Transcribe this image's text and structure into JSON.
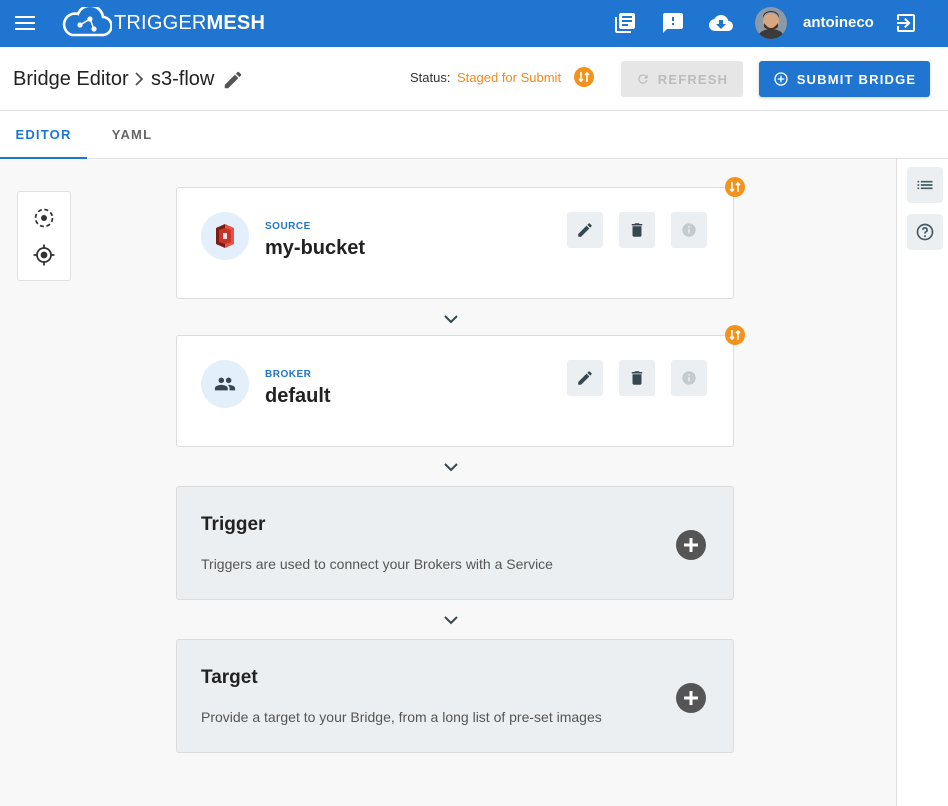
{
  "app": {
    "brand_light": "TRIGGER",
    "brand_bold": "MESH",
    "username": "antoineco",
    "accent_color": "#1f75cf",
    "status_color": "#ef8a1a"
  },
  "breadcrumb": {
    "root": "Bridge Editor",
    "leaf": "s3-flow"
  },
  "status": {
    "label": "Status:",
    "value": "Staged for Submit"
  },
  "buttons": {
    "refresh": "REFRESH",
    "submit": "SUBMIT BRIDGE"
  },
  "tabs": [
    {
      "label": "EDITOR",
      "active": true
    },
    {
      "label": "YAML",
      "active": false
    }
  ],
  "components": [
    {
      "kind": "SOURCE",
      "name": "my-bucket",
      "icon": "aws-s3-icon"
    },
    {
      "kind": "BROKER",
      "name": "default",
      "icon": "group-icon"
    }
  ],
  "placeholders": [
    {
      "title": "Trigger",
      "description": "Triggers are used to connect your Brokers with a Service"
    },
    {
      "title": "Target",
      "description": "Provide a target to your Bridge, from a long list of pre-set images"
    }
  ],
  "icons": {
    "appbar": [
      "menu-icon",
      "library-icon",
      "feedback-icon",
      "cloud-download-icon",
      "logout-icon"
    ],
    "tools": [
      "center-focus-icon",
      "locate-icon"
    ],
    "rail": [
      "list-icon",
      "help-icon"
    ]
  }
}
